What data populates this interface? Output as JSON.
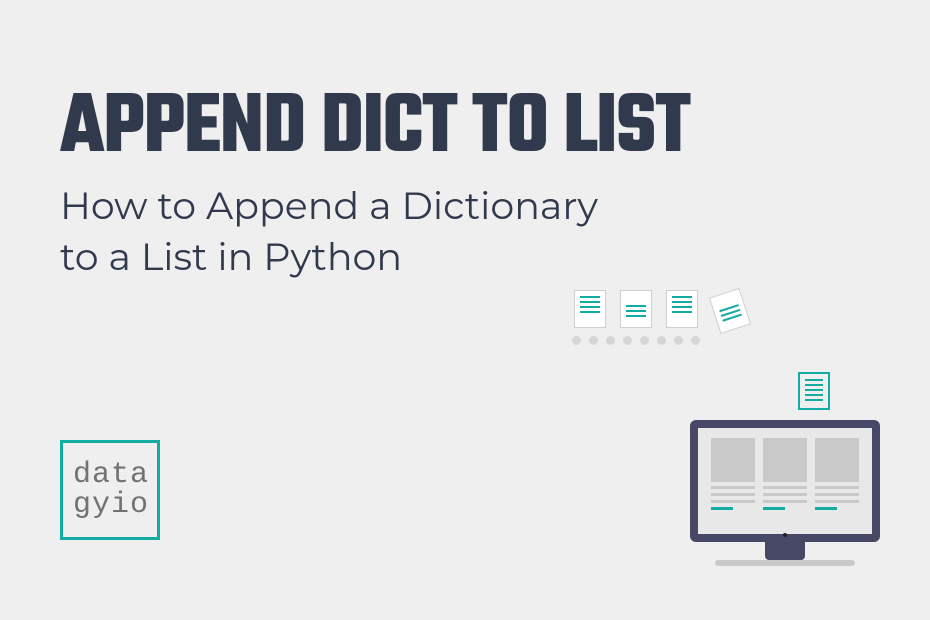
{
  "header": {
    "title": "APPEND DICT TO LIST",
    "subtitle_line1": "How to Append a Dictionary",
    "subtitle_line2": "to a List in Python"
  },
  "logo": {
    "line1": "data",
    "line2": "gyio"
  },
  "colors": {
    "background": "#efefef",
    "text": "#31394d",
    "accent": "#13aca3",
    "monitor_frame": "#464866",
    "grey": "#c9c9c9"
  }
}
